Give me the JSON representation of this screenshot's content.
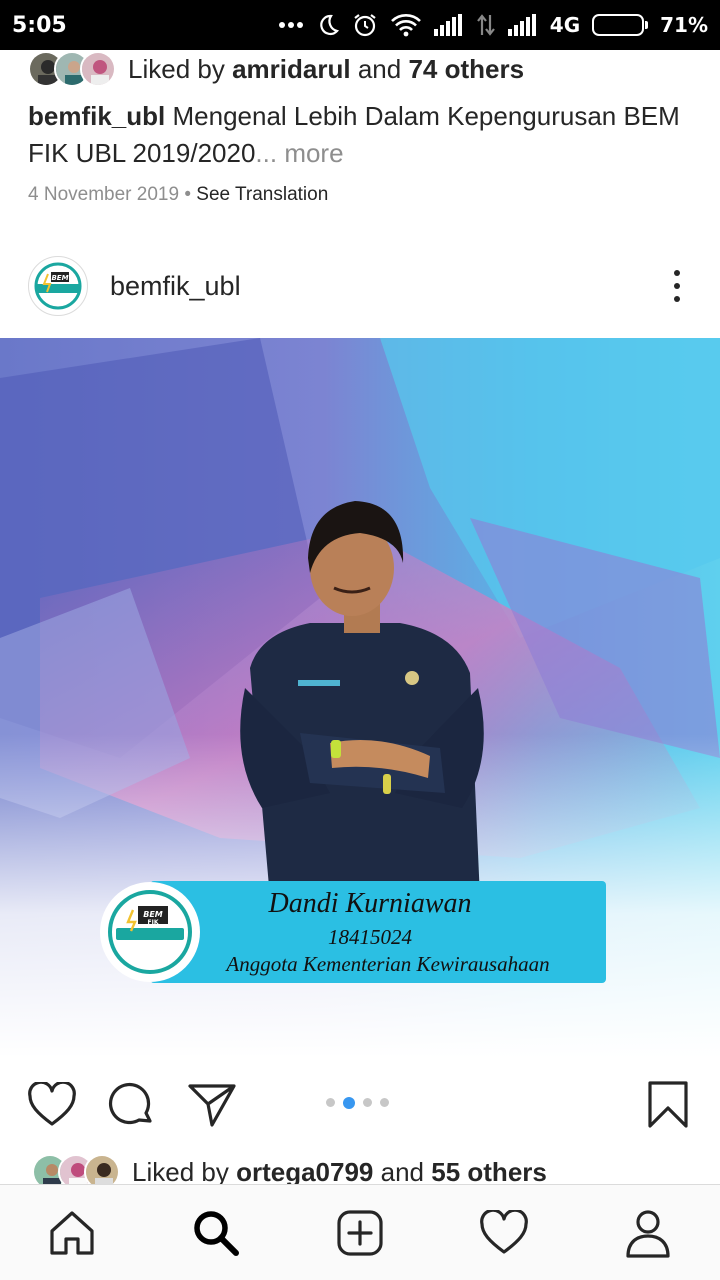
{
  "status_bar": {
    "time": "5:05",
    "network": "4G",
    "battery": "71%",
    "battery_level": 0.71
  },
  "previous_post": {
    "liked_by_prefix": "Liked by",
    "liked_by_user": "amridarul",
    "liked_by_and": "and",
    "liked_by_others": "74 others",
    "caption_user": "bemfik_ubl",
    "caption_text": "Mengenal Lebih Dalam Kepengurusan BEM FIK UBL 2019/2020",
    "caption_more": "... more",
    "date": "4 November 2019",
    "separator": "•",
    "see_translation": "See Translation"
  },
  "post": {
    "username": "bemfik_ubl",
    "image": {
      "logo_text_top": "BEM",
      "logo_text_bottom": "FIK",
      "name": "Dandi Kurniawan",
      "id_number": "18415024",
      "role": "Anggota Kementerian Kewirausahaan"
    },
    "carousel": {
      "count": 4,
      "active_index": 1
    },
    "liked_by_prefix": "Liked by",
    "liked_by_user": "ortega0799",
    "liked_by_and": "and",
    "liked_by_others": "55 others"
  },
  "bottom_nav": [
    "home-icon",
    "search-icon",
    "new-post-icon",
    "activity-icon",
    "profile-icon"
  ],
  "colors": {
    "accent_blue": "#3897f0",
    "banner_cyan": "#2bbfe3",
    "logo_teal": "#1aa7a0"
  }
}
